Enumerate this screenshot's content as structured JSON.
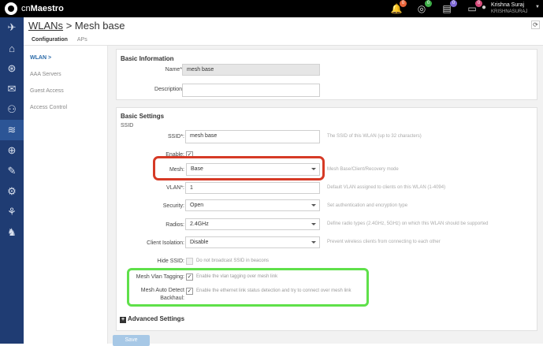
{
  "topbar": {
    "brand_prefix": "cn",
    "brand_name": "Maestro",
    "badges": [
      {
        "icon": "bell-icon",
        "count": "0",
        "color": "#e8643a"
      },
      {
        "icon": "check-circle-icon",
        "count": "0",
        "color": "#3fae49"
      },
      {
        "icon": "clipboard-icon",
        "count": "0",
        "color": "#7f6ad6"
      },
      {
        "icon": "laptop-icon",
        "count": "0",
        "color": "#d64a7a"
      }
    ],
    "user_name": "Krishna Suraj",
    "user_sub": "KRISHNASURAJ"
  },
  "header": {
    "breadcrumb_link": "WLANs",
    "breadcrumb_sep": ">",
    "page_title": "Mesh base",
    "tabs": [
      {
        "label": "Configuration"
      },
      {
        "label": "APs"
      }
    ]
  },
  "subnav": {
    "items": [
      {
        "label": "WLAN >"
      },
      {
        "label": "AAA Servers"
      },
      {
        "label": "Guest Access"
      },
      {
        "label": "Access Control"
      }
    ]
  },
  "basic_info": {
    "title": "Basic Information",
    "name_label": "Name*:",
    "name_value": "mesh base",
    "description_label": "Description:",
    "description_value": ""
  },
  "basic_settings": {
    "title": "Basic Settings",
    "subtitle": "SSID",
    "ssid_label": "SSID*:",
    "ssid_value": "mesh base",
    "ssid_hint": "The SSID of this WLAN (up to 32 characters)",
    "enable_label": "Enable:",
    "enable_checked": "✓",
    "mesh_label": "Mesh:",
    "mesh_value": "Base",
    "mesh_hint": "Mesh Base/Client/Recovery mode",
    "vlan_label": "VLAN*:",
    "vlan_value": "1",
    "vlan_hint": "Default VLAN assigned to clients on this WLAN (1-4094)",
    "security_label": "Security:",
    "security_value": "Open",
    "security_hint": "Set authentication and encryption type",
    "radios_label": "Radios:",
    "radios_value": "2.4GHz",
    "radios_hint": "Define radio types (2.4GHz, 5GHz) on which this WLAN should be supported",
    "isolation_label": "Client Isolation:",
    "isolation_value": "Disable",
    "isolation_hint": "Prevent wireless clients from connecting to each other",
    "hide_ssid_label": "Hide SSID:",
    "hide_ssid_text": "Do not broadcast SSID in beacons",
    "mesh_vlan_label": "Mesh Vlan Tagging:",
    "mesh_vlan_checked": "✓",
    "mesh_vlan_text": "Enable the vlan tagging over mesh link",
    "auto_detect_label_1": "Mesh Auto Detect",
    "auto_detect_label_2": "Backhaul:",
    "auto_detect_checked": "✓",
    "auto_detect_text": "Enable the ethernet link status detection and try to connect over mesh link"
  },
  "advanced": {
    "plus": "+",
    "label": "Advanced Settings"
  },
  "actions": {
    "save_label": "Save"
  },
  "colors": {
    "sidebar": "#1f3c73",
    "highlight_red": "#d63a26",
    "highlight_green": "#5fe04a",
    "save_button": "#a7c8e6"
  }
}
